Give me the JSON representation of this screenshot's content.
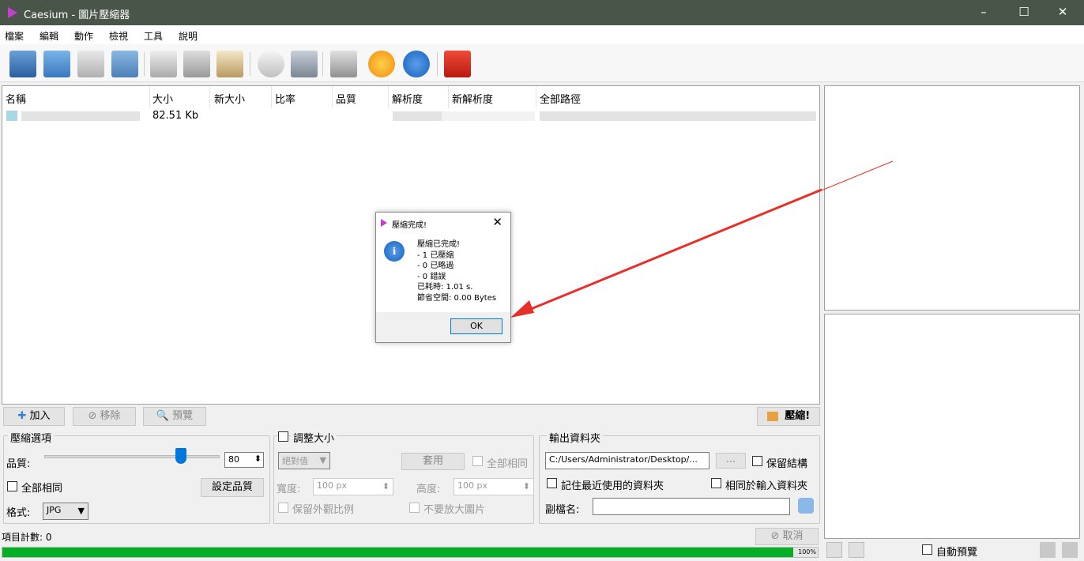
{
  "window": {
    "title": "Caesium - 圖片壓縮器",
    "min": "–",
    "max": "☐",
    "close": "✕"
  },
  "menu": [
    "檔案",
    "編輯",
    "動作",
    "檢視",
    "工具",
    "說明"
  ],
  "table": {
    "headers": [
      "名稱",
      "大小",
      "新大小",
      "比率",
      "品質",
      "解析度",
      "新解析度",
      "全部路徑"
    ],
    "row": {
      "size": "82.51 Kb"
    }
  },
  "buttons": {
    "add": "加入",
    "remove": "移除",
    "preview": "預覽",
    "compress": "壓縮!",
    "cancel": "取消",
    "set_quality": "設定品質",
    "apply": "套用",
    "browse": "...",
    "add_icon": "✚",
    "remove_icon": "⊘",
    "preview_icon": "🔍"
  },
  "compress_options": {
    "title": "壓縮選項",
    "quality_label": "品質:",
    "quality_value": "80",
    "quality_percent": 80,
    "all_same": "全部相同",
    "format_label": "格式:",
    "format_value": "JPG"
  },
  "resize": {
    "title": "調整大小",
    "mode": "絕對值",
    "all_same": "全部相同",
    "width_label": "寬度:",
    "width_value": "100 px",
    "height_label": "高度:",
    "height_value": "100 px",
    "keep_ratio": "保留外觀比例",
    "no_enlarge": "不要放大圖片"
  },
  "output": {
    "title": "輸出資料夾",
    "path": "C:/Users/Administrator/Desktop/...",
    "keep_structure": "保留結構",
    "remember_last": "記住最近使用的資料夾",
    "same_as_input": "相同於輸入資料夾",
    "suffix_label": "副檔名:",
    "suffix_value": ""
  },
  "status": {
    "item_count": "項目計數: 0",
    "progress_percent": 100,
    "progress_label": "100%"
  },
  "preview_panel": {
    "auto_preview": "自動預覽"
  },
  "dialog": {
    "title": "壓縮完成!",
    "close": "✕",
    "lines": [
      "壓縮已完成!",
      "- 1 已壓縮",
      "- 0 已略過",
      "- 0 錯誤",
      "已耗時: 1.01 s.",
      "節省空間: 0.00 Bytes"
    ],
    "ok": "OK"
  },
  "colors": {
    "titlebar": "#4a5549",
    "progress": "#06b025",
    "arrow": "#e8302a"
  }
}
